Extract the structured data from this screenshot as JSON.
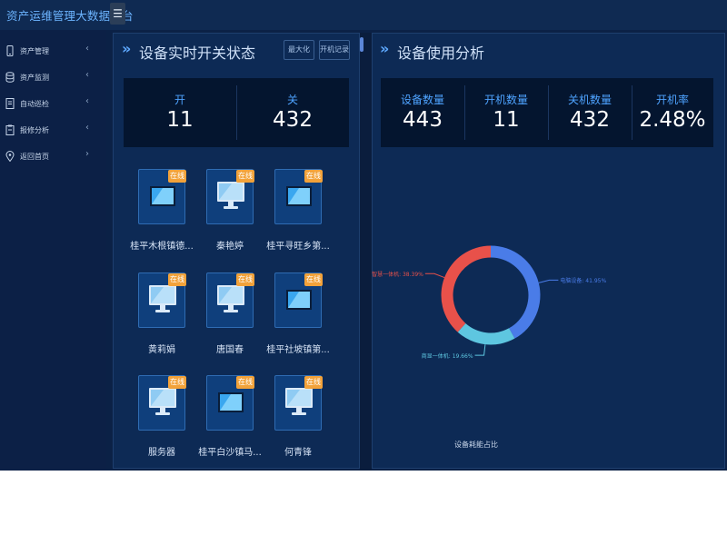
{
  "app": {
    "title": "资产运维管理大数据平台",
    "menu_icon": "hamburger-icon"
  },
  "sidebar": {
    "items": [
      {
        "label": "资产管理",
        "icon": "phone-icon",
        "arrow": "‹"
      },
      {
        "label": "资产监测",
        "icon": "database-icon",
        "arrow": "‹"
      },
      {
        "label": "自动巡检",
        "icon": "document-icon",
        "arrow": "‹"
      },
      {
        "label": "报修分析",
        "icon": "clipboard-icon",
        "arrow": "‹"
      },
      {
        "label": "返回首页",
        "icon": "location-pin-icon",
        "arrow": "›"
      }
    ]
  },
  "left_panel": {
    "title": "设备实时开关状态",
    "buttons": {
      "maximize": "最大化",
      "power_log": "开机记录"
    },
    "stats": [
      {
        "label": "开",
        "value": "11"
      },
      {
        "label": "关",
        "value": "432"
      }
    ],
    "devices": [
      {
        "name": "桂平木根镇德...",
        "badge": "在线",
        "icon": "monitor-off-icon"
      },
      {
        "name": "秦艳婷",
        "badge": "在线",
        "icon": "monitor-on-icon"
      },
      {
        "name": "桂平寻旺乡第...",
        "badge": "在线",
        "icon": "monitor-off-icon"
      },
      {
        "name": "黄莉娟",
        "badge": "在线",
        "icon": "monitor-on-icon"
      },
      {
        "name": "唐国春",
        "badge": "在线",
        "icon": "monitor-on-icon"
      },
      {
        "name": "桂平社坡镇第...",
        "badge": "在线",
        "icon": "monitor-off-icon"
      },
      {
        "name": "服务器",
        "badge": "在线",
        "icon": "monitor-on-icon"
      },
      {
        "name": "桂平白沙镇马...",
        "badge": "在线",
        "icon": "monitor-off-icon"
      },
      {
        "name": "何青锋",
        "badge": "在线",
        "icon": "monitor-on-icon"
      }
    ]
  },
  "right_panel": {
    "title": "设备使用分析",
    "stats": [
      {
        "label": "设备数量",
        "value": "443"
      },
      {
        "label": "开机数量",
        "value": "11"
      },
      {
        "label": "关机数量",
        "value": "432"
      },
      {
        "label": "开机率",
        "value": "2.48%"
      }
    ]
  },
  "chart_data": {
    "type": "pie",
    "title": "设备耗能占比",
    "series": [
      {
        "name": "电脑设备",
        "label": "电脑设备: 41.95%",
        "value": 41.95,
        "color": "#4a7ce8"
      },
      {
        "name": "商显一体机",
        "label": "商显一体机: 19.66%",
        "value": 19.66,
        "color": "#5ec6e0"
      },
      {
        "name": "智慧一体机",
        "label": "智慧一体机: 38.39%",
        "value": 38.39,
        "color": "#e8514a"
      }
    ]
  },
  "colors": {
    "accent": "#4ea3ff",
    "badge": "#f2a23a",
    "background": "#0b2146"
  }
}
